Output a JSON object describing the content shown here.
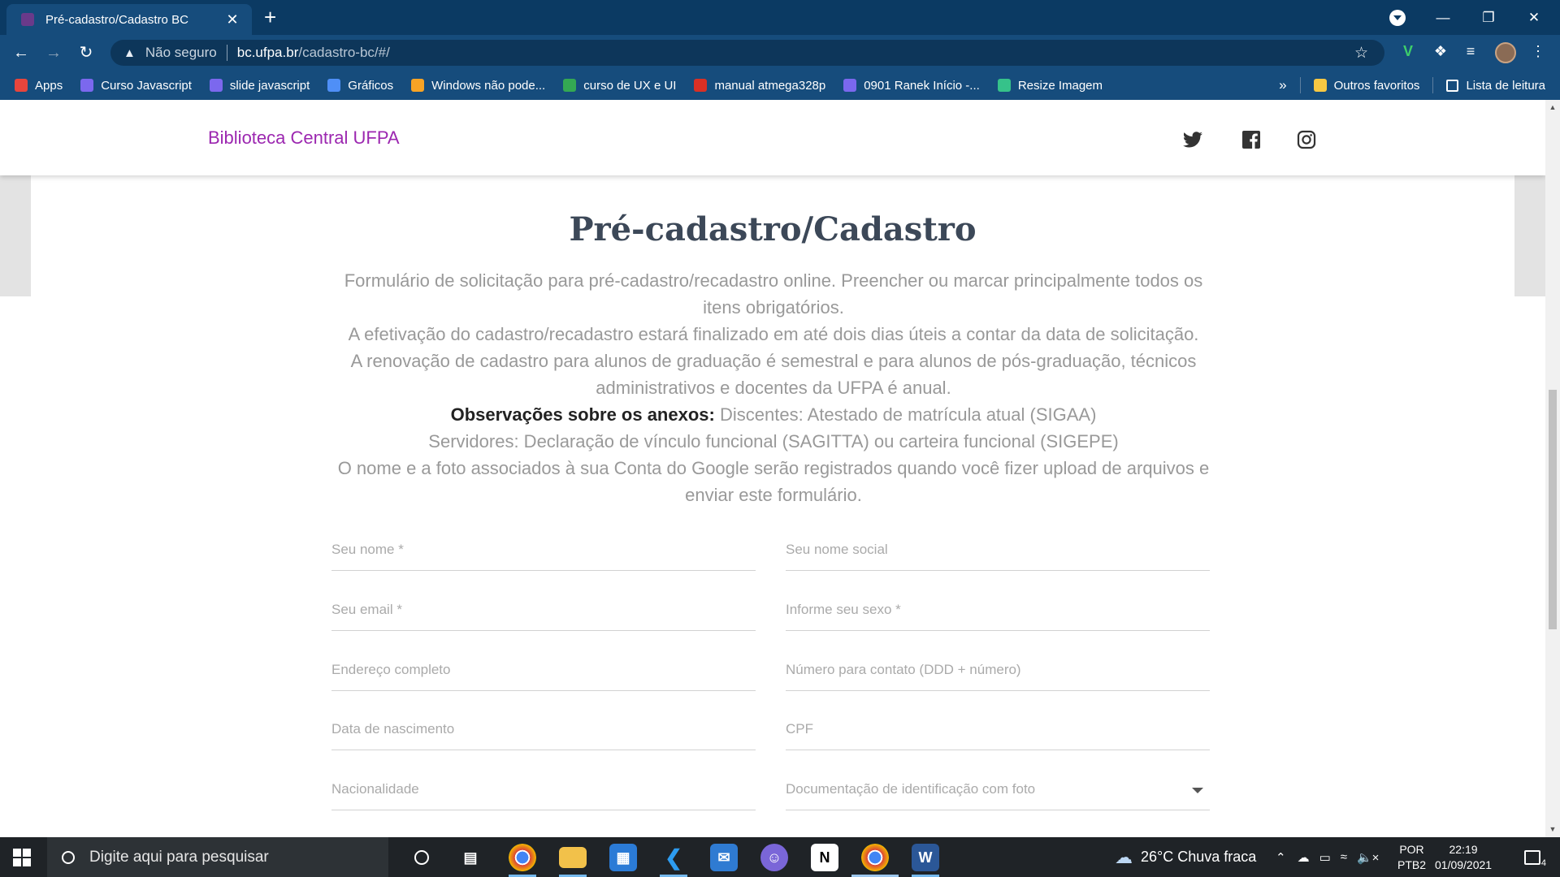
{
  "browser": {
    "tab_title": "Pré-cadastro/Cadastro BC",
    "tab_close": "✕",
    "new_tab": "+",
    "url_security": "Não seguro",
    "url_host": "bc.ufpa.br",
    "url_path": "/cadastro-bc/#/",
    "bookmarks": [
      {
        "label": "Apps",
        "icon": "apps-grid-icon",
        "color": "#e8453c"
      },
      {
        "label": "Curso Javascript",
        "icon": "shield-icon",
        "color": "#7b68ee"
      },
      {
        "label": "slide javascript",
        "icon": "shield-icon",
        "color": "#7b68ee"
      },
      {
        "label": "Gráficos",
        "icon": "chart-icon",
        "color": "#4f8ff7"
      },
      {
        "label": "Windows não pode...",
        "icon": "bookmark-icon",
        "color": "#f7a325"
      },
      {
        "label": "curso de UX e UI",
        "icon": "grid-icon",
        "color": "#34a853"
      },
      {
        "label": "manual atmega328p",
        "icon": "chip-icon",
        "color": "#d93025"
      },
      {
        "label": "0901 Ranek Início -...",
        "icon": "shield-icon",
        "color": "#7b68ee"
      },
      {
        "label": "Resize Imagem",
        "icon": "resize-icon",
        "color": "#36c28a"
      }
    ],
    "bookmarks_more": "»",
    "other_favorites": "Outros favoritos",
    "reading_list": "Lista de leitura"
  },
  "site": {
    "brand": "Biblioteca Central UFPA",
    "social": [
      "twitter-icon",
      "facebook-icon",
      "instagram-icon"
    ]
  },
  "form": {
    "title": "Pré-cadastro/Cadastro",
    "desc_line1": "Formulário de solicitação para pré-cadastro/recadastro online. Preencher ou marcar principalmente todos os itens obrigatórios.",
    "desc_line2": "A efetivação do cadastro/recadastro estará finalizado em até dois dias úteis a contar da data de solicitação.",
    "desc_line3": "A renovação de cadastro para alunos de graduação é semestral e para alunos de pós-graduação, técnicos administrativos e docentes da UFPA é anual.",
    "obs_label": "Observações sobre os anexos:",
    "obs_discentes": "Discentes: Atestado de matrícula atual (SIGAA)",
    "obs_servidores": "Servidores: Declaração de vínculo funcional (SAGITTA) ou carteira funcional (SIGEPE)",
    "desc_google": "O nome e a foto associados à sua Conta do Google serão registrados quando você fizer upload de arquivos e enviar este formulário.",
    "fields": {
      "nome": "Seu nome *",
      "nome_social": "Seu nome social",
      "email": "Seu email *",
      "sexo": "Informe seu sexo *",
      "endereco": "Endereço completo",
      "contato": "Número para contato (DDD + número)",
      "nascimento": "Data de nascimento",
      "cpf": "CPF",
      "nacionalidade": "Nacionalidade",
      "documentacao": "Documentação de identificação com foto"
    }
  },
  "taskbar": {
    "search_placeholder": "Digite aqui para pesquisar",
    "weather": "26°C  Chuva fraca",
    "lang_top": "POR",
    "lang_bottom": "PTB2",
    "time": "22:19",
    "date": "01/09/2021",
    "notifications": "4"
  }
}
